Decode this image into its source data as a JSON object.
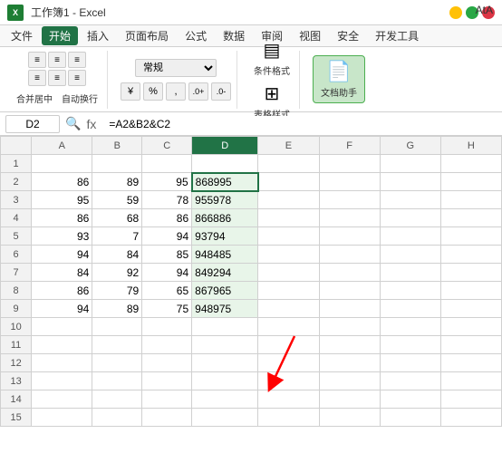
{
  "titleBar": {
    "appName": "Microsoft Excel",
    "fileName": "工作簿1",
    "ataLabel": "AtA"
  },
  "menuBar": {
    "items": [
      "文件",
      "开始",
      "插入",
      "页面布局",
      "公式",
      "数据",
      "审阅",
      "视图",
      "安全",
      "开发工具"
    ],
    "activeItem": "开始"
  },
  "ribbon": {
    "mergeLabel": "合并居中",
    "wrapLabel": "自动换行",
    "formatLabel": "常规",
    "conditionalLabel": "条件格式",
    "tableStyleLabel": "表格样式",
    "assistantLabel": "文档助手",
    "percentSign": "%",
    "commaSign": ",",
    "thousandSign": "000"
  },
  "formulaBar": {
    "cellRef": "D2",
    "formula": "=A2&B2&C2"
  },
  "columns": {
    "rowHeader": "",
    "headers": [
      "A",
      "B",
      "C",
      "D",
      "E",
      "F",
      "G",
      "H"
    ]
  },
  "rows": [
    {
      "rowNum": 1,
      "a": "",
      "b": "",
      "c": "",
      "d": "",
      "e": "",
      "f": "",
      "g": "",
      "h": ""
    },
    {
      "rowNum": 2,
      "a": "86",
      "b": "89",
      "c": "95",
      "d": "868995",
      "e": "",
      "f": "",
      "g": "",
      "h": ""
    },
    {
      "rowNum": 3,
      "a": "95",
      "b": "59",
      "c": "78",
      "d": "955978",
      "e": "",
      "f": "",
      "g": "",
      "h": ""
    },
    {
      "rowNum": 4,
      "a": "86",
      "b": "68",
      "c": "86",
      "d": "866886",
      "e": "",
      "f": "",
      "g": "",
      "h": ""
    },
    {
      "rowNum": 5,
      "a": "93",
      "b": "7",
      "c": "94",
      "d": "93794",
      "e": "",
      "f": "",
      "g": "",
      "h": ""
    },
    {
      "rowNum": 6,
      "a": "94",
      "b": "84",
      "c": "85",
      "d": "948485",
      "e": "",
      "f": "",
      "g": "",
      "h": ""
    },
    {
      "rowNum": 7,
      "a": "84",
      "b": "92",
      "c": "94",
      "d": "849294",
      "e": "",
      "f": "",
      "g": "",
      "h": ""
    },
    {
      "rowNum": 8,
      "a": "86",
      "b": "79",
      "c": "65",
      "d": "867965",
      "e": "",
      "f": "",
      "g": "",
      "h": ""
    },
    {
      "rowNum": 9,
      "a": "94",
      "b": "89",
      "c": "75",
      "d": "948975",
      "e": "",
      "f": "",
      "g": "",
      "h": ""
    },
    {
      "rowNum": 10,
      "a": "",
      "b": "",
      "c": "",
      "d": "",
      "e": "",
      "f": "",
      "g": "",
      "h": ""
    },
    {
      "rowNum": 11,
      "a": "",
      "b": "",
      "c": "",
      "d": "",
      "e": "",
      "f": "",
      "g": "",
      "h": ""
    },
    {
      "rowNum": 12,
      "a": "",
      "b": "",
      "c": "",
      "d": "",
      "e": "",
      "f": "",
      "g": "",
      "h": ""
    },
    {
      "rowNum": 13,
      "a": "",
      "b": "",
      "c": "",
      "d": "",
      "e": "",
      "f": "",
      "g": "",
      "h": ""
    },
    {
      "rowNum": 14,
      "a": "",
      "b": "",
      "c": "",
      "d": "",
      "e": "",
      "f": "",
      "g": "",
      "h": ""
    },
    {
      "rowNum": 15,
      "a": "",
      "b": "",
      "c": "",
      "d": "",
      "e": "",
      "f": "",
      "g": "",
      "h": ""
    }
  ]
}
